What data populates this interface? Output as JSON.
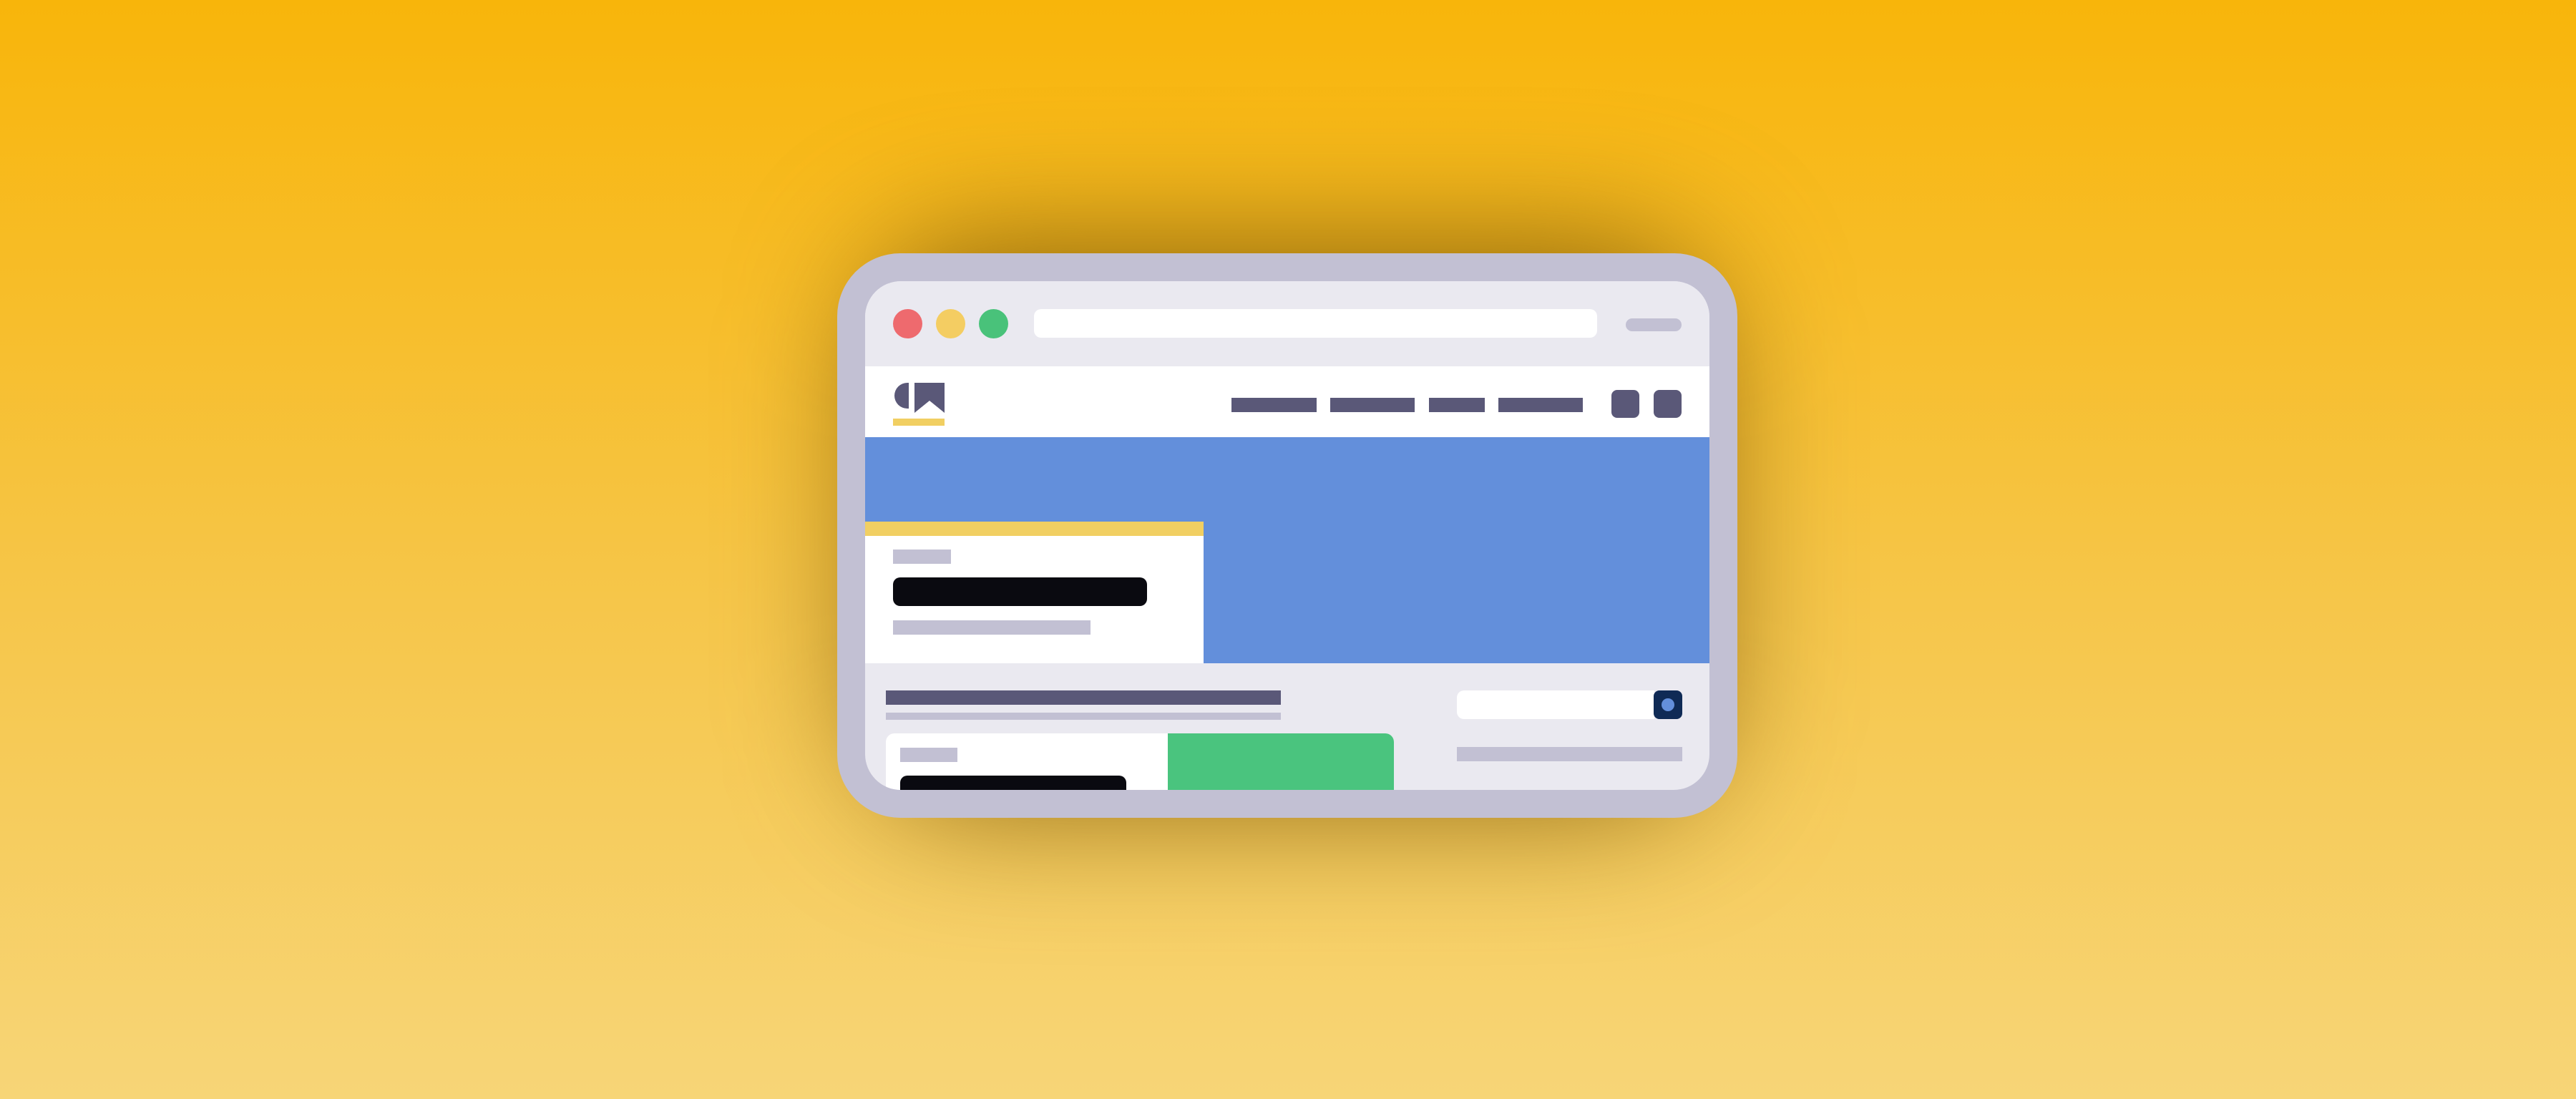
{
  "colors": {
    "background_top": "#f8b50a",
    "background_bottom": "#f7d577",
    "device_frame": "#c2c0d3",
    "window_chrome": "#eae9f0",
    "close_dot": "#ee6a6e",
    "minimize_dot": "#f4cd62",
    "maximize_dot": "#49c27a",
    "nav_ink": "#5a5878",
    "accent_yellow": "#f1cf62",
    "hero_blue": "#638fdb",
    "headline_black": "#0a0a10",
    "placeholder_gray": "#c2c0d3",
    "card_green": "#4ac47e",
    "search_button": "#0f2a55"
  },
  "icons": {
    "logo": "brand-logo-icon",
    "nav_square_1": "square-icon",
    "nav_square_2": "square-icon",
    "search_button": "search-dot-icon"
  },
  "nav": {
    "link_count": 4
  }
}
